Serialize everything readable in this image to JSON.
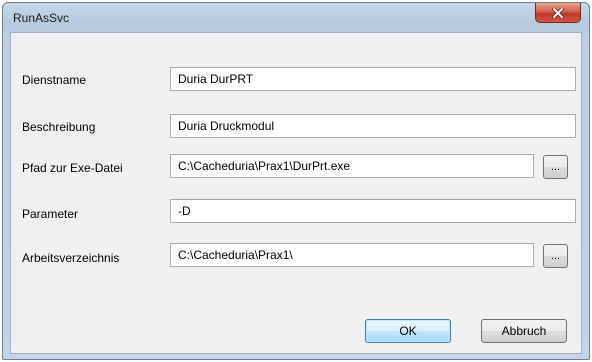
{
  "window": {
    "title": "RunAsSvc"
  },
  "fields": {
    "dienstname": {
      "label": "Dienstname",
      "value": "Duria DurPRT"
    },
    "beschreibung": {
      "label": "Beschreibung",
      "value": "Duria Druckmodul"
    },
    "pfad": {
      "label": "Pfad zur Exe-Datei",
      "value": "C:\\Cacheduria\\Prax1\\DurPrt.exe",
      "browse_label": "..."
    },
    "parameter": {
      "label": "Parameter",
      "value": "-D"
    },
    "arbeitsverzeichnis": {
      "label": "Arbeitsverzeichnis",
      "value": "C:\\Cacheduria\\Prax1\\",
      "browse_label": "..."
    }
  },
  "buttons": {
    "ok_label": "OK",
    "cancel_label": "Abbruch"
  },
  "icons": {
    "close": "close-icon"
  },
  "colors": {
    "title_bar": "#b9cde2",
    "close_button": "#c8412f",
    "default_button_border": "#3c7fb1"
  }
}
